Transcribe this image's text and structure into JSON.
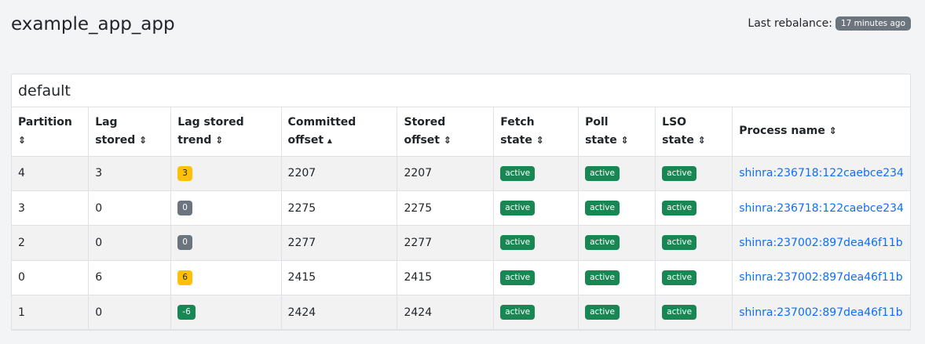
{
  "page": {
    "title": "example_app_app"
  },
  "rebalance": {
    "label": "Last rebalance:",
    "time": "17 minutes ago"
  },
  "card": {
    "title": "default"
  },
  "columns": [
    {
      "line1": "Partition",
      "line2": "",
      "sort": "⇕"
    },
    {
      "line1": "Lag",
      "line2": "stored",
      "sort": "⇕"
    },
    {
      "line1": "Lag stored",
      "line2": "trend",
      "sort": "⇕"
    },
    {
      "line1": "Committed",
      "line2": "offset",
      "sort": "▴"
    },
    {
      "line1": "Stored",
      "line2": "offset",
      "sort": "⇕"
    },
    {
      "line1": "Fetch",
      "line2": "state",
      "sort": "⇕"
    },
    {
      "line1": "Poll",
      "line2": "state",
      "sort": "⇕"
    },
    {
      "line1": "LSO",
      "line2": "state",
      "sort": "⇕"
    },
    {
      "line1": "Process name",
      "line2": "",
      "sort": "⇕"
    }
  ],
  "rows": [
    {
      "partition": "4",
      "lag": "3",
      "trend": "3",
      "trend_variant": "warning",
      "committed": "2207",
      "stored": "2207",
      "fetch": "active",
      "poll": "active",
      "lso": "active",
      "process": "shinra:236718:122caebce234"
    },
    {
      "partition": "3",
      "lag": "0",
      "trend": "0",
      "trend_variant": "secondary",
      "committed": "2275",
      "stored": "2275",
      "fetch": "active",
      "poll": "active",
      "lso": "active",
      "process": "shinra:236718:122caebce234"
    },
    {
      "partition": "2",
      "lag": "0",
      "trend": "0",
      "trend_variant": "secondary",
      "committed": "2277",
      "stored": "2277",
      "fetch": "active",
      "poll": "active",
      "lso": "active",
      "process": "shinra:237002:897dea46f11b"
    },
    {
      "partition": "0",
      "lag": "6",
      "trend": "6",
      "trend_variant": "warning",
      "committed": "2415",
      "stored": "2415",
      "fetch": "active",
      "poll": "active",
      "lso": "active",
      "process": "shinra:237002:897dea46f11b"
    },
    {
      "partition": "1",
      "lag": "0",
      "trend": "-6",
      "trend_variant": "success",
      "committed": "2424",
      "stored": "2424",
      "fetch": "active",
      "poll": "active",
      "lso": "active",
      "process": "shinra:237002:897dea46f11b"
    }
  ],
  "colors": {
    "warning": "#ffc107",
    "secondary": "#6c757d",
    "success": "#198754",
    "link": "#0d6efd"
  }
}
